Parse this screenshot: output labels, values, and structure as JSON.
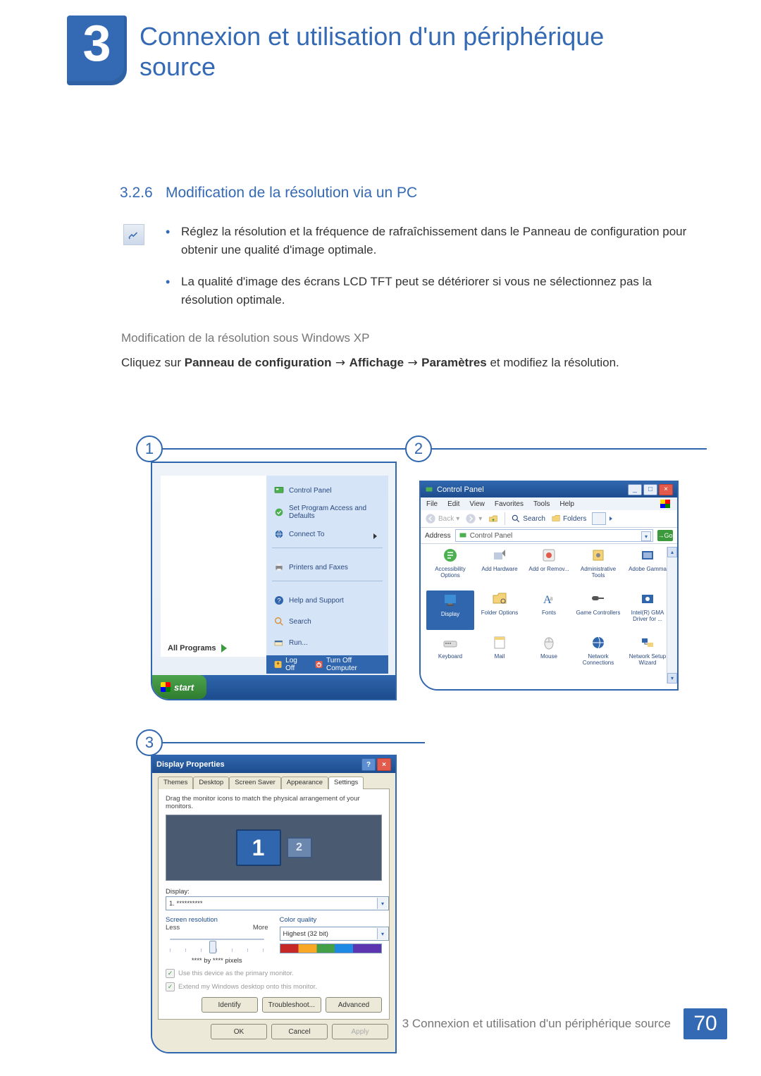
{
  "chapter": {
    "number": "3",
    "title": "Connexion et utilisation d'un périphérique source"
  },
  "section": {
    "number": "3.2.6",
    "title": "Modification de la résolution via un PC"
  },
  "notes": [
    "Réglez la résolution et la fréquence de rafraîchissement dans le Panneau de configuration pour obtenir une qualité d'image optimale.",
    "La qualité d'image des écrans LCD TFT peut se détériorer si vous ne sélectionnez pas la résolution optimale."
  ],
  "subheading": "Modification de la résolution sous Windows XP",
  "instruction": {
    "prefix": "Cliquez sur ",
    "b1": "Panneau de configuration",
    "arrow": " → ",
    "b2": "Affichage",
    "b3": "Paramètres",
    "suffix": " et modifiez la résolution."
  },
  "callouts": {
    "c1": "1",
    "c2": "2",
    "c3": "3"
  },
  "startMenu": {
    "right": [
      "Control Panel",
      "Set Program Access and Defaults",
      "Connect To",
      "Printers and Faxes",
      "Help and Support",
      "Search",
      "Run..."
    ],
    "allPrograms": "All Programs",
    "logOff": "Log Off",
    "turnOff": "Turn Off Computer",
    "start": "start"
  },
  "controlPanel": {
    "title": "Control Panel",
    "menu": [
      "File",
      "Edit",
      "View",
      "Favorites",
      "Tools",
      "Help"
    ],
    "toolbar": {
      "back": "Back",
      "search": "Search",
      "folders": "Folders"
    },
    "addressLabel": "Address",
    "addressValue": "Control Panel",
    "go": "Go",
    "items": [
      "Accessibility Options",
      "Add Hardware",
      "Add or Remov...",
      "Administrative Tools",
      "Adobe Gamma",
      "Display",
      "Folder Options",
      "Fonts",
      "Game Controllers",
      "Intel(R) GMA Driver for ...",
      "Keyboard",
      "Mail",
      "Mouse",
      "Network Connections",
      "Network Setup Wizard"
    ],
    "selectedIndex": 5
  },
  "displayProps": {
    "title": "Display Properties",
    "tabs": [
      "Themes",
      "Desktop",
      "Screen Saver",
      "Appearance",
      "Settings"
    ],
    "activeTab": "Settings",
    "dragHint": "Drag the monitor icons to match the physical arrangement of your monitors.",
    "mon1": "1",
    "mon2": "2",
    "displayLabel": "Display:",
    "displayValue": "1. **********",
    "resLabel": "Screen resolution",
    "less": "Less",
    "more": "More",
    "pixels": "**** by **** pixels",
    "cqLabel": "Color quality",
    "cqValue": "Highest (32 bit)",
    "chk1": "Use this device as the primary monitor.",
    "chk2": "Extend my Windows desktop onto this monitor.",
    "identify": "Identify",
    "troubleshoot": "Troubleshoot...",
    "advanced": "Advanced",
    "ok": "OK",
    "cancel": "Cancel",
    "apply": "Apply"
  },
  "footer": {
    "text": "3 Connexion et utilisation d'un périphérique source",
    "page": "70"
  }
}
